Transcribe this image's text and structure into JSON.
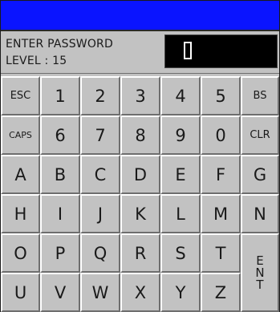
{
  "prompt": {
    "line1": "ENTER PASSWORD",
    "line2": "LEVEL : 15"
  },
  "password_field": {
    "value": "▯"
  },
  "keys": {
    "row1": [
      "ESC",
      "1",
      "2",
      "3",
      "4",
      "5",
      "BS"
    ],
    "row2": [
      "CAPS",
      "6",
      "7",
      "8",
      "9",
      "0",
      "CLR"
    ],
    "row3": [
      "A",
      "B",
      "C",
      "D",
      "E",
      "F",
      "G"
    ],
    "row4": [
      "H",
      "I",
      "J",
      "K",
      "L",
      "M",
      "N"
    ],
    "row5": [
      "O",
      "P",
      "Q",
      "R",
      "S",
      "T"
    ],
    "row6": [
      "U",
      "V",
      "W",
      "X",
      "Y",
      "Z"
    ],
    "enter": [
      "E",
      "N",
      "T"
    ]
  },
  "colors": {
    "titlebar": "#0a14ff",
    "panel": "#c2c2c2",
    "field": "#000000"
  }
}
